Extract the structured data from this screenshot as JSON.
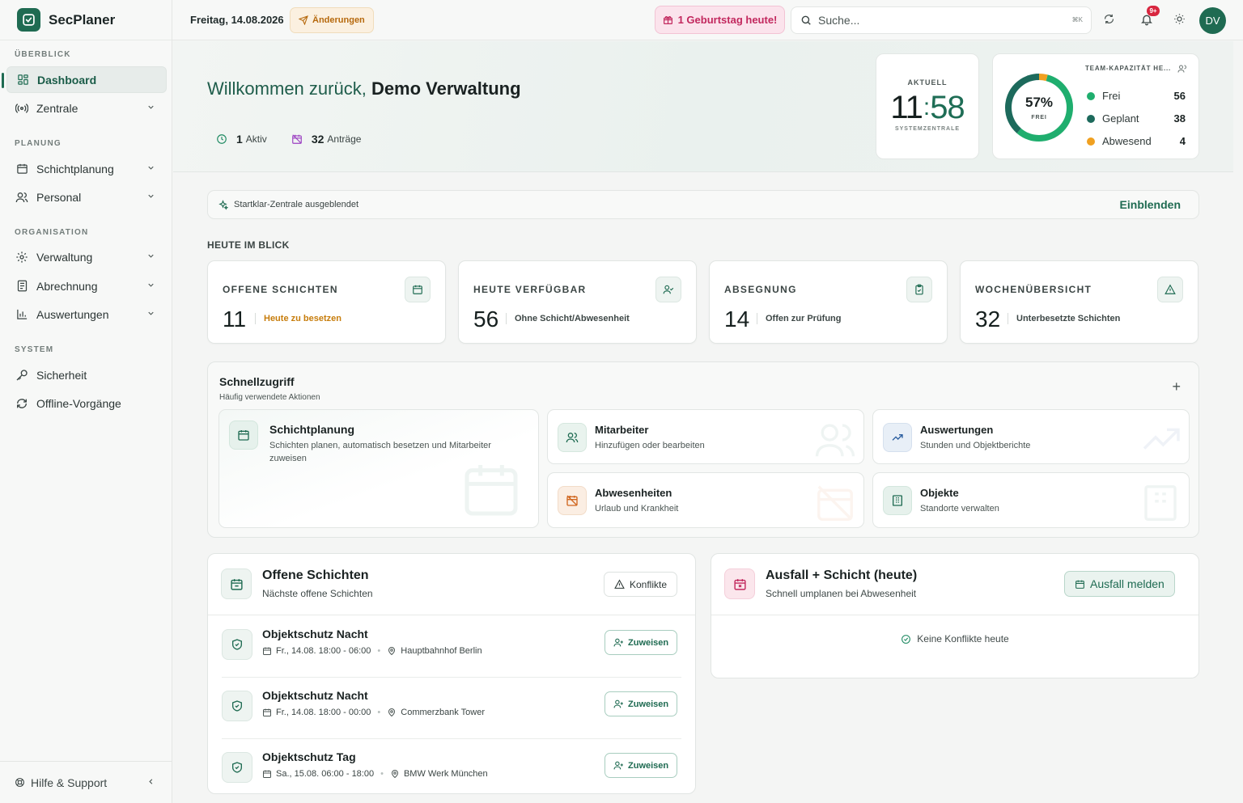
{
  "app": {
    "name": "SecPlaner"
  },
  "sidebar": {
    "sections": [
      "ÜBERBLICK",
      "PLANUNG",
      "ORGANISATION",
      "SYSTEM"
    ],
    "items": [
      {
        "label": "Dashboard",
        "icon": "grid-icon"
      },
      {
        "label": "Zentrale",
        "icon": "broadcast-icon"
      },
      {
        "label": "Schichtplanung",
        "icon": "calendar-icon"
      },
      {
        "label": "Personal",
        "icon": "users-icon"
      },
      {
        "label": "Verwaltung",
        "icon": "gear-icon"
      },
      {
        "label": "Abrechnung",
        "icon": "document-icon"
      },
      {
        "label": "Auswertungen",
        "icon": "bar-chart-icon"
      },
      {
        "label": "Sicherheit",
        "icon": "key-icon"
      },
      {
        "label": "Offline-Vorgänge",
        "icon": "sync-icon"
      }
    ],
    "footer": "Hilfe & Support"
  },
  "topbar": {
    "date": "Freitag, 14.08.2026",
    "changes": "Änderungen",
    "birthday": "1 Geburtstag heute!",
    "search_placeholder": "Suche...",
    "shortcut": "⌘K",
    "notification_count": "9+",
    "avatar": "DV"
  },
  "hero": {
    "welcome": "Willkommen zurück,",
    "name": "Demo Verwaltung",
    "active_count": "1",
    "active_label": "Aktiv",
    "requests_count": "32",
    "requests_label": "Anträge",
    "clock_label": "AKTUELL",
    "clock_hour": "11",
    "clock_minute": "58",
    "clock_sub": "SYSTEMZENTRALE",
    "capacity_title": "TEAM-KAPAZITÄT HE...",
    "capacity_percent": "57%",
    "capacity_percent_label": "FREI",
    "capacity": [
      {
        "label": "Frei",
        "value": "56",
        "color": "#1fae6e"
      },
      {
        "label": "Geplant",
        "value": "38",
        "color": "#1d6a5c"
      },
      {
        "label": "Abwesend",
        "value": "4",
        "color": "#f0a020"
      }
    ]
  },
  "startklar": {
    "text": "Startklar-Zentrale ausgeblendet",
    "action": "Einblenden"
  },
  "today": {
    "heading": "HEUTE IM BLICK",
    "kpis": [
      {
        "title": "OFFENE SCHICHTEN",
        "value": "11",
        "sub": "Heute zu besetzen"
      },
      {
        "title": "HEUTE VERFÜGBAR",
        "value": "56",
        "sub": "Ohne Schicht/Abwesenheit"
      },
      {
        "title": "ABSEGNUNG",
        "value": "14",
        "sub": "Offen zur Prüfung"
      },
      {
        "title": "WOCHENÜBERSICHT",
        "value": "32",
        "sub": "Unterbesetzte Schichten"
      }
    ]
  },
  "quick": {
    "title": "Schnellzugriff",
    "subtitle": "Häufig verwendete Aktionen",
    "items": [
      {
        "title": "Schichtplanung",
        "desc": "Schichten planen, automatisch besetzen und Mitarbeiter zuweisen"
      },
      {
        "title": "Mitarbeiter",
        "desc": "Hinzufügen oder bearbeiten"
      },
      {
        "title": "Auswertungen",
        "desc": "Stunden und Objektberichte"
      },
      {
        "title": "Abwesenheiten",
        "desc": "Urlaub und Krankheit"
      },
      {
        "title": "Objekte",
        "desc": "Standorte verwalten"
      }
    ]
  },
  "open_shifts": {
    "title": "Offene Schichten",
    "subtitle": "Nächste offene Schichten",
    "conflicts_btn": "Konflikte",
    "assign_label": "Zuweisen",
    "rows": [
      {
        "title": "Objektschutz Nacht",
        "time": "Fr., 14.08. 18:00 - 06:00",
        "location": "Hauptbahnhof Berlin"
      },
      {
        "title": "Objektschutz Nacht",
        "time": "Fr., 14.08. 18:00 - 00:00",
        "location": "Commerzbank Tower"
      },
      {
        "title": "Objektschutz Tag",
        "time": "Sa., 15.08. 06:00 - 18:00",
        "location": "BMW Werk München"
      }
    ]
  },
  "absence": {
    "title": "Ausfall + Schicht (heute)",
    "subtitle": "Schnell umplanen bei Abwesenheit",
    "button": "Ausfall melden",
    "empty": "Keine Konflikte heute"
  }
}
